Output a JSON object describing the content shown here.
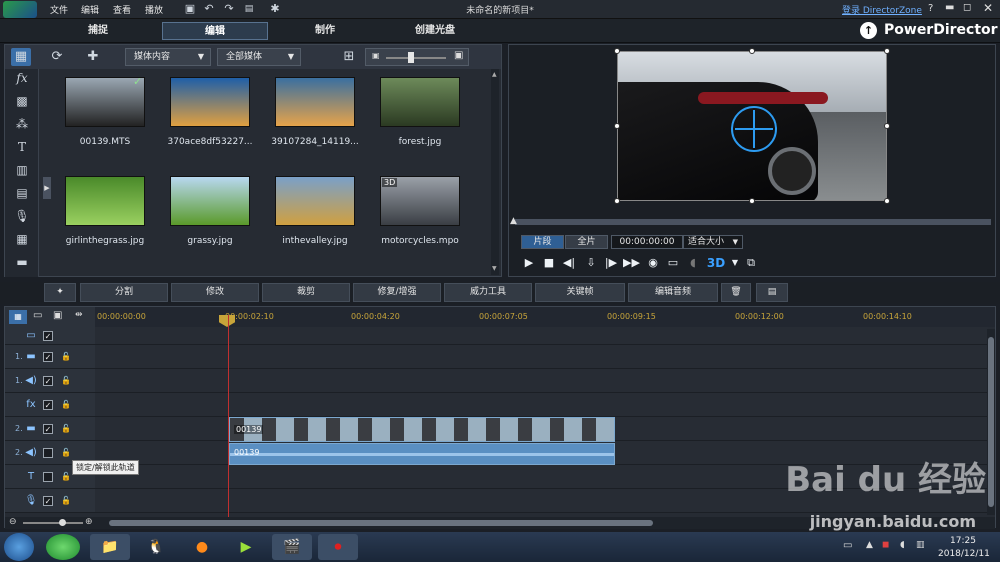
{
  "menu": {
    "file": "文件",
    "edit": "编辑",
    "view": "查看",
    "play": "播放"
  },
  "window_title": "未命名的新项目*",
  "login_link": "登录 DirectorZone",
  "help": "?",
  "brand": "PowerDirector",
  "modes": {
    "capture": "捕捉",
    "edit": "编辑",
    "produce": "制作",
    "disc": "创建光盘"
  },
  "library": {
    "filter1": "媒体内容",
    "filter2": "全部媒体",
    "items": [
      {
        "name": "00139.MTS",
        "color1": "#9aa7b2",
        "color2": "#222"
      },
      {
        "name": "370ace8df53227...",
        "color1": "#1f5fa8",
        "color2": "#e0a040"
      },
      {
        "name": "39107284_14119...",
        "color1": "#3a6fa0",
        "color2": "#e6a34a"
      },
      {
        "name": "forest.jpg",
        "color1": "#6d8a5a",
        "color2": "#2b3a22"
      },
      {
        "name": "girlinthegrass.jpg",
        "color1": "#4a8a2a",
        "color2": "#9ad060"
      },
      {
        "name": "grassy.jpg",
        "color1": "#b8d8f0",
        "color2": "#5a9a2a"
      },
      {
        "name": "inthevalley.jpg",
        "color1": "#7aa0c8",
        "color2": "#d0a040"
      },
      {
        "name": "motorcycles.mpo",
        "color1": "#9aa0a8",
        "color2": "#3a3e44"
      }
    ],
    "badge_3d": "3D"
  },
  "preview": {
    "seg_clip": "片段",
    "seg_full": "全片",
    "timecode": "00:00:00:00",
    "fit": "适合大小",
    "mode_3d": "3D"
  },
  "edit_buttons": {
    "split": "分割",
    "modify": "修改",
    "crop": "裁剪",
    "fix": "修复/增强",
    "power": "威力工具",
    "keyframe": "关键帧",
    "audio": "编辑音频"
  },
  "timeline": {
    "ticks": [
      "00:00:00:00",
      "00:00:02:10",
      "00:00:04:20",
      "00:00:07:05",
      "00:00:09:15",
      "00:00:12:00",
      "00:00:14:10"
    ],
    "tracks": [
      "1.",
      "1.",
      "2.",
      "2."
    ],
    "clip_video": "00139",
    "clip_audio": "00139"
  },
  "tooltip": "锁定/解锁此轨道",
  "clock": {
    "time": "17:25",
    "date": "2018/12/11"
  },
  "watermark": {
    "logo": "Bai du 经验",
    "url": "jingyan.baidu.com"
  }
}
